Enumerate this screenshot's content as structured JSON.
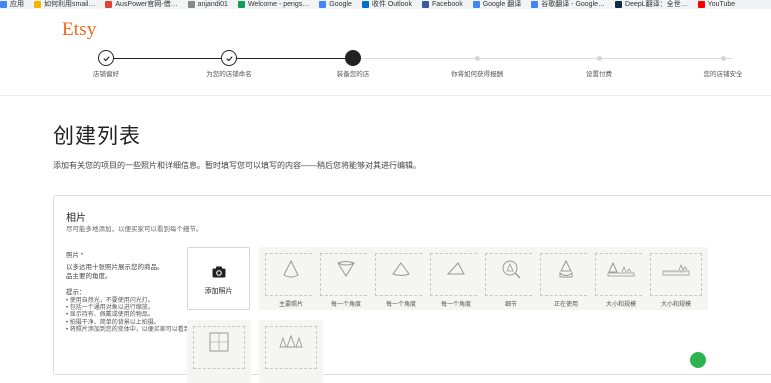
{
  "bookmarks": [
    {
      "label": "应用",
      "color": "#4285f4"
    },
    {
      "label": "如何利用smail…",
      "color": "#f4b400"
    },
    {
      "label": "AusPower官网-借…",
      "color": "#db4437"
    },
    {
      "label": "anjandi01",
      "color": "#888888"
    },
    {
      "label": "Welcome - pengs…",
      "color": "#0f9d58"
    },
    {
      "label": "Google",
      "color": "#4285f4"
    },
    {
      "label": "收件 Outlook",
      "color": "#0072c6"
    },
    {
      "label": "Facebook",
      "color": "#3b5998"
    },
    {
      "label": "Google 翻译",
      "color": "#4285f4"
    },
    {
      "label": "谷歌翻译 - Google…",
      "color": "#4285f4"
    },
    {
      "label": "DeepL翻译：全世…",
      "color": "#0f2b46"
    },
    {
      "label": "YouTube",
      "color": "#ff0000"
    }
  ],
  "brand": {
    "logo": "Etsy",
    "color": "#f1641e"
  },
  "steps": [
    {
      "label": "店铺偏好",
      "state": "done"
    },
    {
      "label": "为您的店铺命名",
      "state": "done"
    },
    {
      "label": "装备您的店",
      "state": "current"
    },
    {
      "label": "你将如何获得报酬",
      "state": "future"
    },
    {
      "label": "设置付费",
      "state": "future"
    },
    {
      "label": "您的店铺安全",
      "state": "future"
    }
  ],
  "page": {
    "title": "创建列表",
    "subtitle": "添加有关您的项目的一些照片和详细信息。暂时填写您可以填写的内容——稍后您将能够对其进行编辑。"
  },
  "photos": {
    "title": "相片",
    "desc": "尽可能多地添加，以便买家可以看到每个细节。",
    "label": "照片 *",
    "help": "以多达用十张照片展示您的商品。",
    "help2": "品主要的角度。",
    "tips_title": "提示：",
    "tips": [
      "使用自然光，不要使用闪光灯。",
      "包括一个通用对象以进行缩放。",
      "显示持有、佩戴或使用的物品。",
      "拍摄干净、简单的背景以上拍摄。",
      "将照片添加到您的变体中，以便买家可以看到所有选项。"
    ],
    "add_label": "添加照片",
    "tiles": [
      {
        "label": "主要照片",
        "icon": "cone-icon"
      },
      {
        "label": "每一个角度",
        "icon": "cone-down-icon"
      },
      {
        "label": "每一个角度",
        "icon": "cone-side-icon"
      },
      {
        "label": "每一个角度",
        "icon": "cone-tilt-icon"
      },
      {
        "label": "细节",
        "icon": "magnify-icon"
      },
      {
        "label": "正在使用",
        "icon": "cone-hand-icon"
      },
      {
        "label": "大小和规模",
        "icon": "ruler-icon"
      },
      {
        "label": "",
        "icon": "frame-icon"
      },
      {
        "label": "",
        "icon": "variations-icon"
      }
    ]
  }
}
